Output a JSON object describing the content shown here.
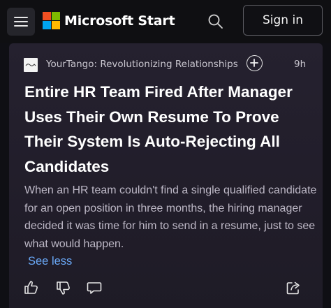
{
  "header": {
    "brand": "Microsoft Start",
    "signin_label": "Sign in",
    "icons": [
      "menu-icon",
      "microsoft-logo",
      "search-icon"
    ]
  },
  "article": {
    "source": "YourTango: Revolutionizing Relationships",
    "time": "9h",
    "headline": "Entire HR Team Fired After Manager Uses Their Own Resume To Prove Their System Is Auto-Rejecting All Candidates",
    "summary": "When an HR team couldn't find a single qualified candidate for an open position in three months, the hiring manager decided it was time for him to send in a resume, just to see what would happen.",
    "see_less": "See less"
  },
  "actions": [
    "thumbs-up-icon",
    "thumbs-down-icon",
    "comment-icon",
    "share-icon"
  ],
  "colors": {
    "background": "#0f0f14",
    "card": "#24202d",
    "link": "#6aa8f7",
    "summary_text": "#bdb8c6"
  }
}
